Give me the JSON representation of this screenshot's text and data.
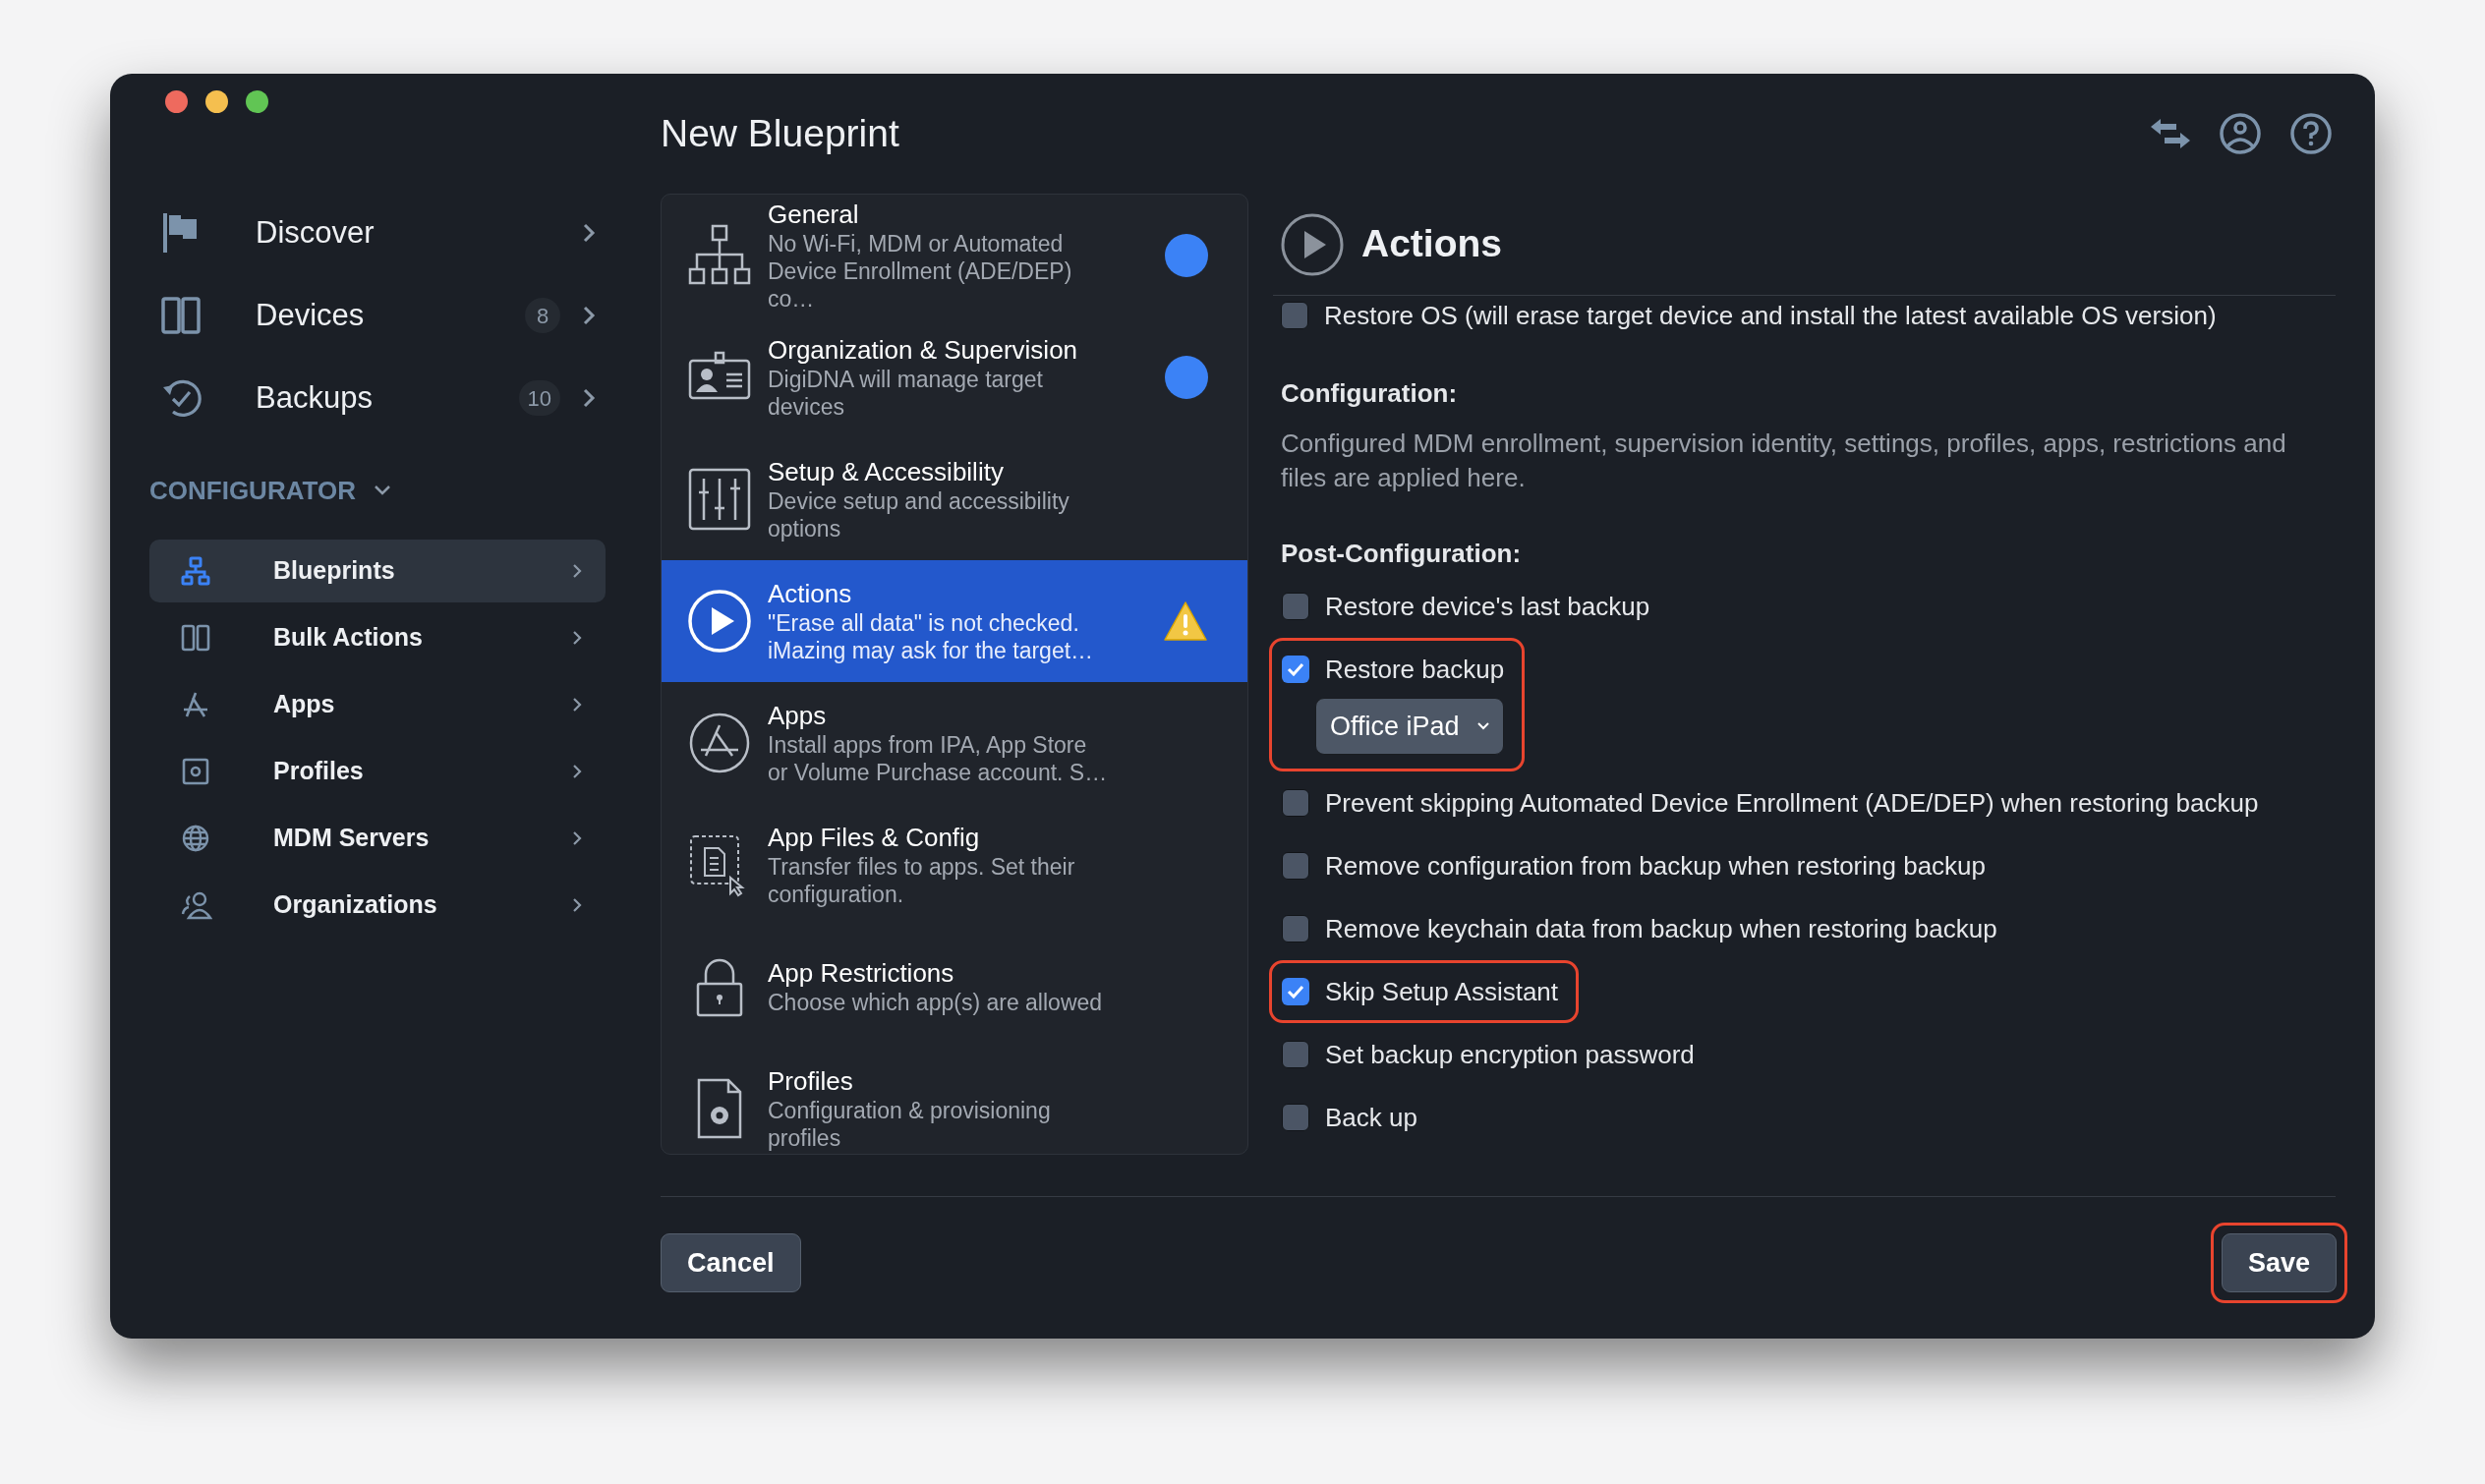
{
  "window": {
    "title": "New Blueprint"
  },
  "sidebar": {
    "items": [
      {
        "label": "Discover"
      },
      {
        "label": "Devices",
        "count": "8"
      },
      {
        "label": "Backups",
        "count": "10"
      }
    ],
    "section": {
      "label": "CONFIGURATOR",
      "expanded": true,
      "items": [
        {
          "label": "Blueprints",
          "selected": true
        },
        {
          "label": "Bulk Actions",
          "selected": false
        },
        {
          "label": "Apps",
          "selected": false
        },
        {
          "label": "Profiles",
          "selected": false
        },
        {
          "label": "MDM Servers",
          "selected": false
        },
        {
          "label": "Organizations",
          "selected": false
        }
      ]
    }
  },
  "steps": [
    {
      "title": "General",
      "description": "No Wi-Fi, MDM or Automated Device Enrollment (ADE/DEP) co…",
      "kind": "done",
      "selected": false
    },
    {
      "title": "Organization & Supervision",
      "description": "DigiDNA will manage target devices",
      "kind": "done",
      "selected": false
    },
    {
      "title": "Setup & Accessibility",
      "description": "Device setup and accessibility options",
      "kind": "plain",
      "selected": false
    },
    {
      "title": "Actions",
      "description": "\"Erase all data\" is not checked. iMazing may ask for the target…",
      "kind": "warning",
      "selected": true
    },
    {
      "title": "Apps",
      "description": "Install apps from IPA, App Store or Volume Purchase account. S…",
      "kind": "plain",
      "selected": false
    },
    {
      "title": "App Files & Config",
      "description": "Transfer files to apps. Set their configuration.",
      "kind": "plain",
      "selected": false
    },
    {
      "title": "App Restrictions",
      "description": "Choose which app(s) are allowed",
      "kind": "plain",
      "selected": false
    },
    {
      "title": "Profiles",
      "description": "Configuration & provisioning profiles",
      "kind": "plain",
      "selected": false
    }
  ],
  "detail": {
    "title": "Actions",
    "top_option": {
      "label": "Restore OS (will erase target device and install the latest available OS version)",
      "checked": false
    },
    "configuration": {
      "heading": "Configuration:",
      "text": "Configured MDM enrollment, supervision identity, settings, profiles, apps, restrictions and files are applied here."
    },
    "post_configuration": {
      "heading": "Post-Configuration:",
      "options": [
        {
          "label": "Restore device's last backup",
          "checked": false,
          "highlighted": false
        },
        {
          "label": "Restore backup",
          "checked": true,
          "highlighted": true,
          "dropdown": "Office iPad"
        },
        {
          "label": "Prevent skipping Automated Device Enrollment (ADE/DEP) when restoring backup",
          "checked": false,
          "highlighted": false
        },
        {
          "label": "Remove configuration from backup when restoring backup",
          "checked": false,
          "highlighted": false
        },
        {
          "label": "Remove keychain data from backup when restoring backup",
          "checked": false,
          "highlighted": false
        },
        {
          "label": "Skip Setup Assistant",
          "checked": true,
          "highlighted": true
        },
        {
          "label": "Set backup encryption password",
          "checked": false,
          "highlighted": false
        },
        {
          "label": "Back up",
          "checked": false,
          "highlighted": false
        }
      ]
    }
  },
  "buttons": {
    "cancel": "Cancel",
    "save": {
      "label": "Save",
      "highlighted": true
    }
  }
}
